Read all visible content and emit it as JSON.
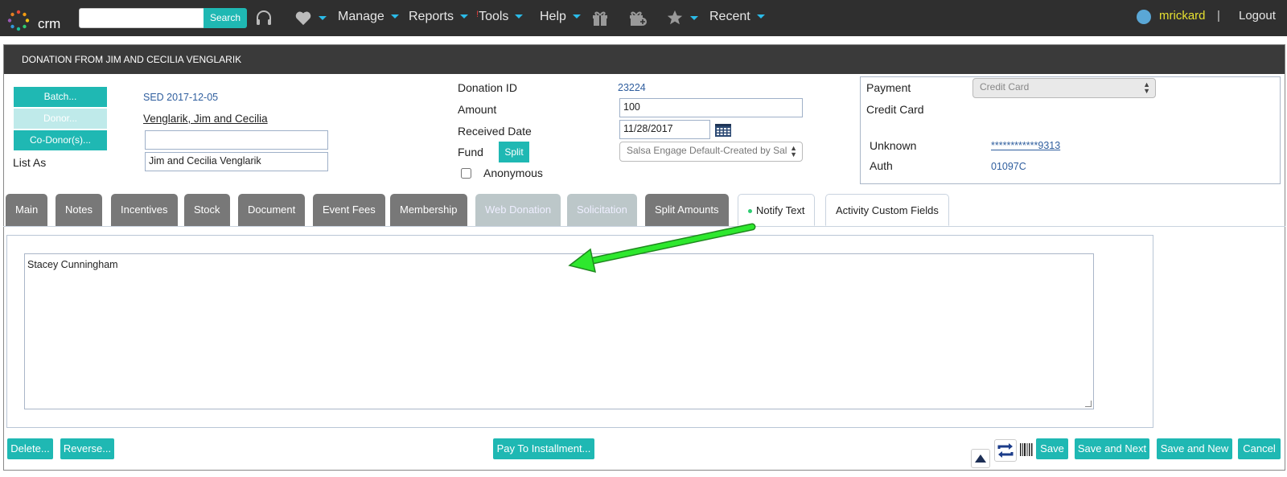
{
  "nav": {
    "logo_text": "crm",
    "search_placeholder": "",
    "search_button": "Search",
    "manage": "Manage",
    "reports": "Reports",
    "tools_alert": "!",
    "tools": "Tools",
    "help": "Help",
    "recent": "Recent",
    "user": "mrickard",
    "separator": "|",
    "logout": "Logout"
  },
  "panel": {
    "title": "DONATION FROM JIM AND CECILIA VENGLARIK"
  },
  "left": {
    "batch_button": "Batch...",
    "donor_button": "Donor...",
    "codonor_button": "Co-Donor(s)...",
    "batch_value": "SED 2017-12-05",
    "donor_value": "Venglarik, Jim and Cecilia",
    "codonor_value": "",
    "list_as_label": "List As",
    "list_as_value": "Jim and Cecilia Venglarik"
  },
  "middle": {
    "donation_id_label": "Donation ID",
    "donation_id_value": "23224",
    "amount_label": "Amount",
    "amount_value": "100",
    "received_date_label": "Received Date",
    "received_date_value": "11/28/2017",
    "fund_label": "Fund",
    "split_button": "Split",
    "fund_value": "Salsa Engage Default-Created by Sal",
    "anonymous_label": "Anonymous"
  },
  "payment": {
    "payment_label": "Payment",
    "payment_value": "Credit Card",
    "method_label": "Credit Card",
    "unknown_label": "Unknown",
    "card_number": "************9313",
    "auth_label": "Auth",
    "auth_value": "01097C"
  },
  "tabs": [
    {
      "label": "Main"
    },
    {
      "label": "Notes"
    },
    {
      "label": "Incentives"
    },
    {
      "label": "Stock"
    },
    {
      "label": "Document"
    },
    {
      "label": "Event Fees"
    },
    {
      "label": "Membership"
    },
    {
      "label": "Web Donation"
    },
    {
      "label": "Solicitation"
    },
    {
      "label": "Split Amounts"
    },
    {
      "label": "Notify Text"
    },
    {
      "label": "Activity Custom Fields"
    }
  ],
  "notify_text": "Stacey Cunningham",
  "footer": {
    "delete": "Delete...",
    "reverse": "Reverse...",
    "pay_to_installment": "Pay To Installment...",
    "save": "Save",
    "save_and_next": "Save and Next",
    "save_and_new": "Save and New",
    "cancel": "Cancel"
  },
  "colors": {
    "accent": "#1fb8b3",
    "nav_bg": "#2f2f2f",
    "caret": "#2bbbe8",
    "user": "#e5e030",
    "arrow": "#2ee82e"
  }
}
